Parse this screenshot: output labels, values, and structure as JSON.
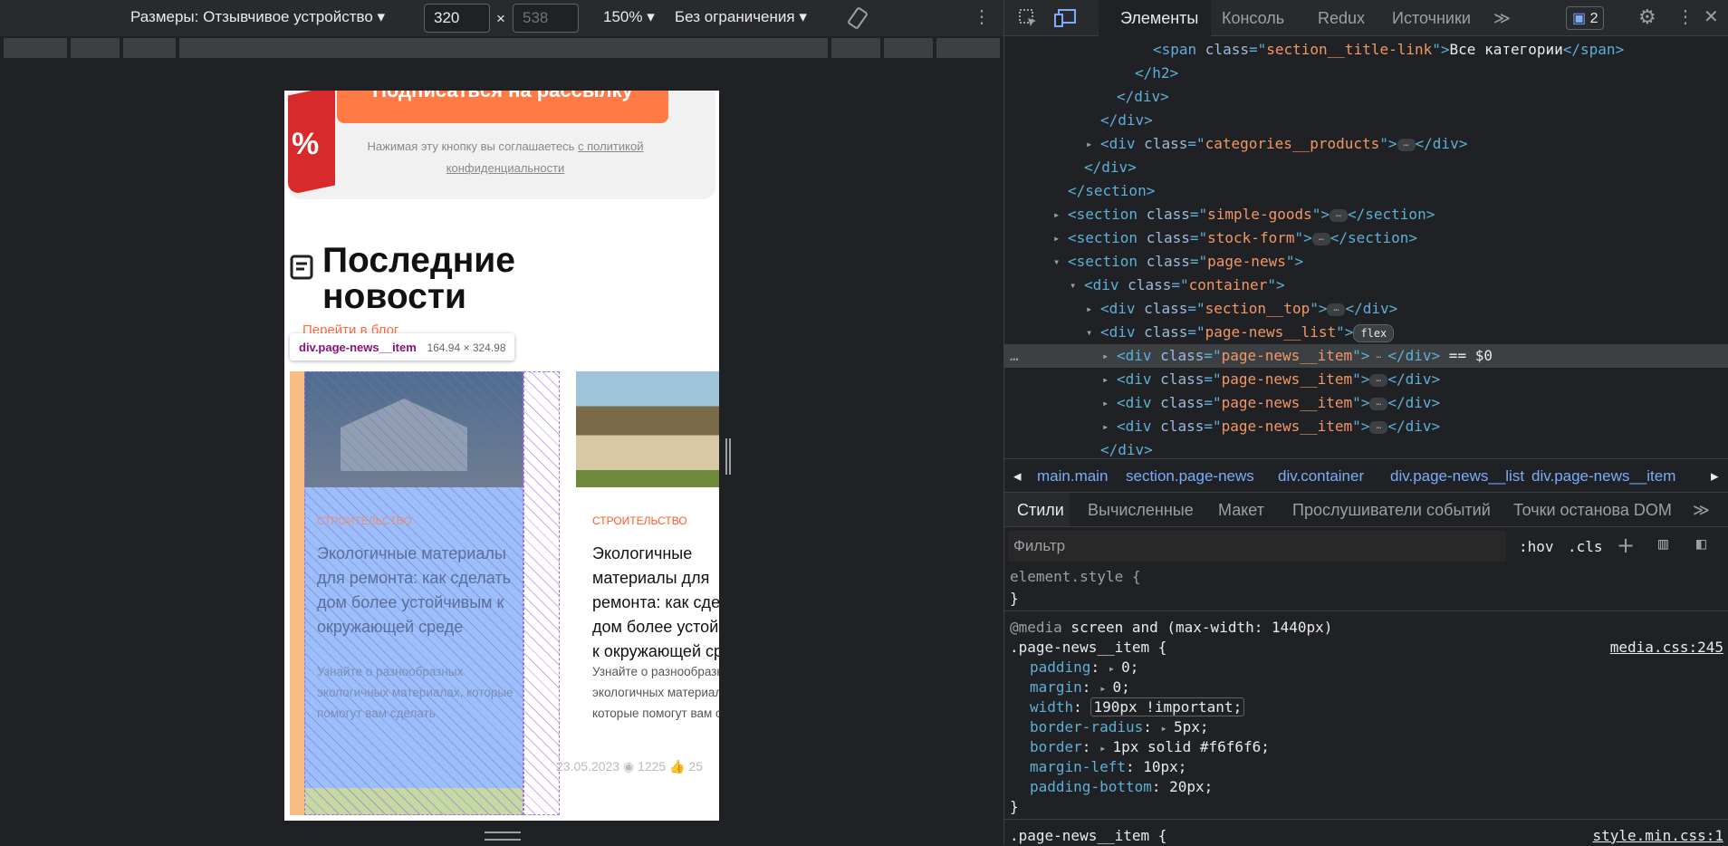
{
  "device_toolbar": {
    "dimensions_label": "Размеры: Отзывчивое устройство",
    "width": "320",
    "height_placeholder": "538",
    "times": "×",
    "zoom": "150%",
    "throttle": "Без ограничения"
  },
  "page": {
    "subscribe_button": "Подписаться на рассылку",
    "consent_text": "Нажимая эту кнопку вы соглашаетесь",
    "consent_link_1": "с политикой",
    "consent_link_2": "конфиденциальности",
    "percent_badge": "%",
    "news_title_1": "Последние",
    "news_title_2": "новости",
    "blog_link": "Перейти в блог",
    "tooltip_selector": "div.page-news__item",
    "tooltip_size": "164.94 × 324.98",
    "cards": [
      {
        "category": "СТРОИТЕЛЬСТВО",
        "title": "Экологичные материалы для ремонта: как сделать дом более устойчивым к окружающей среде",
        "excerpt": "Узнайте о разнообразных экологичных материалах, которые помогут вам сделать"
      },
      {
        "category": "СТРОИТЕЛЬСТВО",
        "title_lines": [
          "Экологичные",
          "материалы для",
          "ремонта: как сделат",
          "дом более устойчие",
          "к окружающей сред"
        ],
        "excerpt_lines": [
          "Узнайте о разнообразны",
          "экологичных материалах",
          "которые помогут вам сде"
        ],
        "date": "23.05.2023",
        "views": "1225",
        "likes": "25"
      }
    ]
  },
  "devtools": {
    "tabs": [
      "Элементы",
      "Консоль",
      "Redux",
      "Источники"
    ],
    "issues_count": "2",
    "dom_lines": [
      {
        "indent": 0,
        "open": false,
        "parts": [
          [
            "tag",
            "<span "
          ],
          [
            "an",
            "class"
          ],
          [
            "tag",
            "=\""
          ],
          [
            "av",
            "section__title-link"
          ],
          [
            "tag",
            "\">"
          ],
          [
            "txt",
            "Все категории"
          ],
          [
            "tag",
            "</span>"
          ]
        ]
      },
      {
        "indent": 0,
        "parts": [
          [
            "tag",
            "</h2>"
          ]
        ]
      },
      {
        "indent": 0,
        "parts": [
          [
            "tag",
            "</div>"
          ]
        ]
      },
      {
        "indent": 0,
        "parts": [
          [
            "tag",
            "</div>"
          ]
        ]
      },
      {
        "indent": 0,
        "parts": [
          [
            "tag",
            "<div "
          ],
          [
            "an",
            "class"
          ],
          [
            "tag",
            "=\""
          ],
          [
            "av",
            "categories__products"
          ],
          [
            "tag",
            "\">"
          ],
          [
            "ell",
            "…"
          ],
          [
            "tag",
            "</div>"
          ]
        ]
      },
      {
        "indent": 0,
        "parts": [
          [
            "tag",
            "</div>"
          ]
        ]
      },
      {
        "indent": 0,
        "parts": [
          [
            "tag",
            "</section>"
          ]
        ]
      },
      {
        "indent": 0,
        "parts": [
          [
            "tag",
            "<section "
          ],
          [
            "an",
            "class"
          ],
          [
            "tag",
            "=\""
          ],
          [
            "av",
            "simple-goods"
          ],
          [
            "tag",
            "\">"
          ],
          [
            "ell",
            "…"
          ],
          [
            "tag",
            "</section>"
          ]
        ]
      },
      {
        "indent": 0,
        "parts": [
          [
            "tag",
            "<section "
          ],
          [
            "an",
            "class"
          ],
          [
            "tag",
            "=\""
          ],
          [
            "av",
            "stock-form"
          ],
          [
            "tag",
            "\">"
          ],
          [
            "ell",
            "…"
          ],
          [
            "tag",
            "</section>"
          ]
        ]
      },
      {
        "indent": 0,
        "parts": [
          [
            "tag",
            "<section "
          ],
          [
            "an",
            "class"
          ],
          [
            "tag",
            "=\""
          ],
          [
            "av",
            "page-news"
          ],
          [
            "tag",
            "\">"
          ]
        ]
      },
      {
        "indent": 0,
        "parts": [
          [
            "tag",
            "<div "
          ],
          [
            "an",
            "class"
          ],
          [
            "tag",
            "=\""
          ],
          [
            "av",
            "container"
          ],
          [
            "tag",
            "\">"
          ]
        ]
      },
      {
        "indent": 0,
        "parts": [
          [
            "tag",
            "<div "
          ],
          [
            "an",
            "class"
          ],
          [
            "tag",
            "=\""
          ],
          [
            "av",
            "section__top"
          ],
          [
            "tag",
            "\">"
          ],
          [
            "ell",
            "…"
          ],
          [
            "tag",
            "</div>"
          ]
        ]
      },
      {
        "indent": 0,
        "parts": [
          [
            "tag",
            "<div "
          ],
          [
            "an",
            "class"
          ],
          [
            "tag",
            "=\""
          ],
          [
            "av",
            "page-news__list"
          ],
          [
            "tag",
            "\">"
          ],
          [
            "flex",
            "flex"
          ]
        ]
      },
      {
        "indent": 0,
        "parts": [
          [
            "tag",
            "<div "
          ],
          [
            "an",
            "class"
          ],
          [
            "tag",
            "=\""
          ],
          [
            "av",
            "page-news__item"
          ],
          [
            "tag",
            "\">"
          ],
          [
            "ell",
            "…"
          ],
          [
            "tag",
            "</div>"
          ],
          [
            "txt",
            " == $0"
          ]
        ]
      },
      {
        "indent": 0,
        "parts": [
          [
            "tag",
            "<div "
          ],
          [
            "an",
            "class"
          ],
          [
            "tag",
            "=\""
          ],
          [
            "av",
            "page-news__item"
          ],
          [
            "tag",
            "\">"
          ],
          [
            "ell",
            "…"
          ],
          [
            "tag",
            "</div>"
          ]
        ]
      },
      {
        "indent": 0,
        "parts": [
          [
            "tag",
            "<div "
          ],
          [
            "an",
            "class"
          ],
          [
            "tag",
            "=\""
          ],
          [
            "av",
            "page-news__item"
          ],
          [
            "tag",
            "\">"
          ],
          [
            "ell",
            "…"
          ],
          [
            "tag",
            "</div>"
          ]
        ]
      },
      {
        "indent": 0,
        "parts": [
          [
            "tag",
            "<div "
          ],
          [
            "an",
            "class"
          ],
          [
            "tag",
            "=\""
          ],
          [
            "av",
            "page-news__item"
          ],
          [
            "tag",
            "\">"
          ],
          [
            "ell",
            "…"
          ],
          [
            "tag",
            "</div>"
          ]
        ]
      },
      {
        "indent": 0,
        "parts": [
          [
            "tag",
            "</div>"
          ]
        ]
      }
    ],
    "breadcrumbs": [
      "main.main",
      "section.page-news",
      "div.container",
      "div.page-news__list",
      "div.page-news__item"
    ],
    "style_tabs": [
      "Стили",
      "Вычисленные",
      "Макет",
      "Прослушиватели событий",
      "Точки останова DOM"
    ],
    "filter_placeholder": "Фильтр",
    "hov": ":hov",
    "cls": ".cls",
    "styles": {
      "element_style": "element.style {",
      "close": "}",
      "media_kw": "@media",
      "media_query": " screen and (max-width: 1440px)",
      "rule_selector": ".page-news__item {",
      "rule_source": "media.css:245",
      "props": [
        {
          "name": "padding",
          "value": "0;",
          "arrow": true
        },
        {
          "name": "margin",
          "value": "0;",
          "arrow": true
        },
        {
          "name": "width",
          "value": "190px !important;",
          "arrow": false
        },
        {
          "name": "border-radius",
          "value": "5px;",
          "arrow": true
        },
        {
          "name": "border",
          "value": "1px solid #f6f6f6;",
          "arrow": true
        },
        {
          "name": "margin-left",
          "value": "10px;",
          "arrow": false
        },
        {
          "name": "padding-bottom",
          "value": "20px;",
          "arrow": false
        }
      ],
      "next_selector": ".page-news__item {",
      "next_source": "style.min.css:1"
    }
  },
  "colors": {
    "accent": "#ff7a45",
    "overlay": "#8ab4f8"
  }
}
